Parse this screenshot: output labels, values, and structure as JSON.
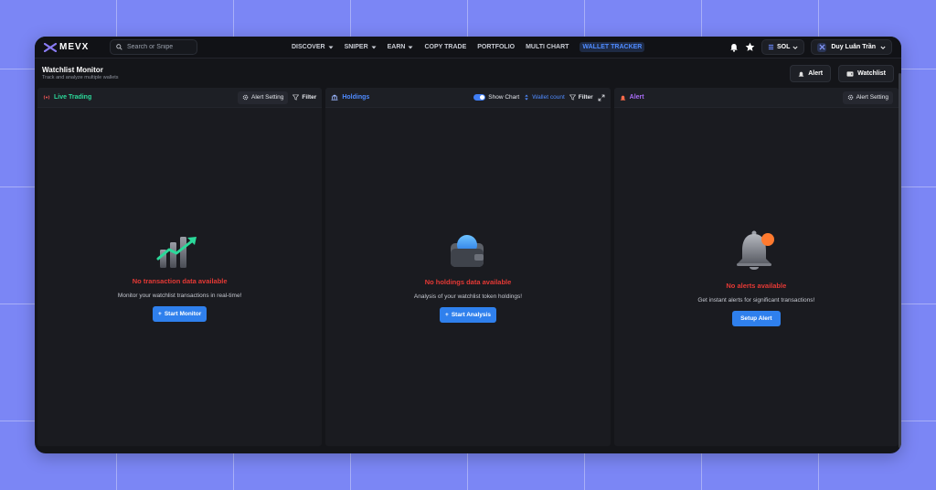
{
  "app": {
    "logo_text": "MEVX"
  },
  "search": {
    "placeholder": "Search or Snipe"
  },
  "nav": {
    "items": [
      {
        "label": "DISCOVER",
        "has_dropdown": true
      },
      {
        "label": "SNIPER",
        "has_dropdown": true
      },
      {
        "label": "EARN",
        "has_dropdown": true
      },
      {
        "label": "COPY TRADE",
        "has_dropdown": false
      },
      {
        "label": "PORTFOLIO",
        "has_dropdown": false
      },
      {
        "label": "MULTI CHART",
        "has_dropdown": false
      },
      {
        "label": "WALLET TRACKER",
        "has_dropdown": false,
        "active": true
      }
    ]
  },
  "topbar_right": {
    "chain_label": "SOL",
    "user_name": "Duy Luân Trần"
  },
  "header": {
    "title": "Watchlist Monitor",
    "subtitle": "Track and analyze multiple wallets",
    "alert_label": "Alert",
    "watchlist_label": "Watchlist"
  },
  "panels": {
    "live": {
      "title": "Live Trading",
      "alert_setting": "Alert Setting",
      "filter": "Filter",
      "empty_title": "No transaction data available",
      "empty_sub": "Monitor your watchlist transactions in real-time!",
      "cta": "Start Monitor"
    },
    "holdings": {
      "title": "Holdings",
      "show_chart": "Show Chart",
      "wallet_count": "Wallet count",
      "filter": "Filter",
      "empty_title": "No holdings data available",
      "empty_sub": "Analysis of your watchlist token holdings!",
      "cta": "Start Analysis"
    },
    "alert": {
      "title": "Alert",
      "alert_setting": "Alert Setting",
      "empty_title": "No alerts available",
      "empty_sub": "Get instant alerts for significant transactions!",
      "cta": "Setup Alert"
    }
  },
  "colors": {
    "accent": "#2f80ed",
    "error": "#e53935",
    "live_title": "#2bd99a",
    "holdings_title": "#4f8bff",
    "alert_title": "#a86cf5",
    "background": "#7b86f5"
  }
}
